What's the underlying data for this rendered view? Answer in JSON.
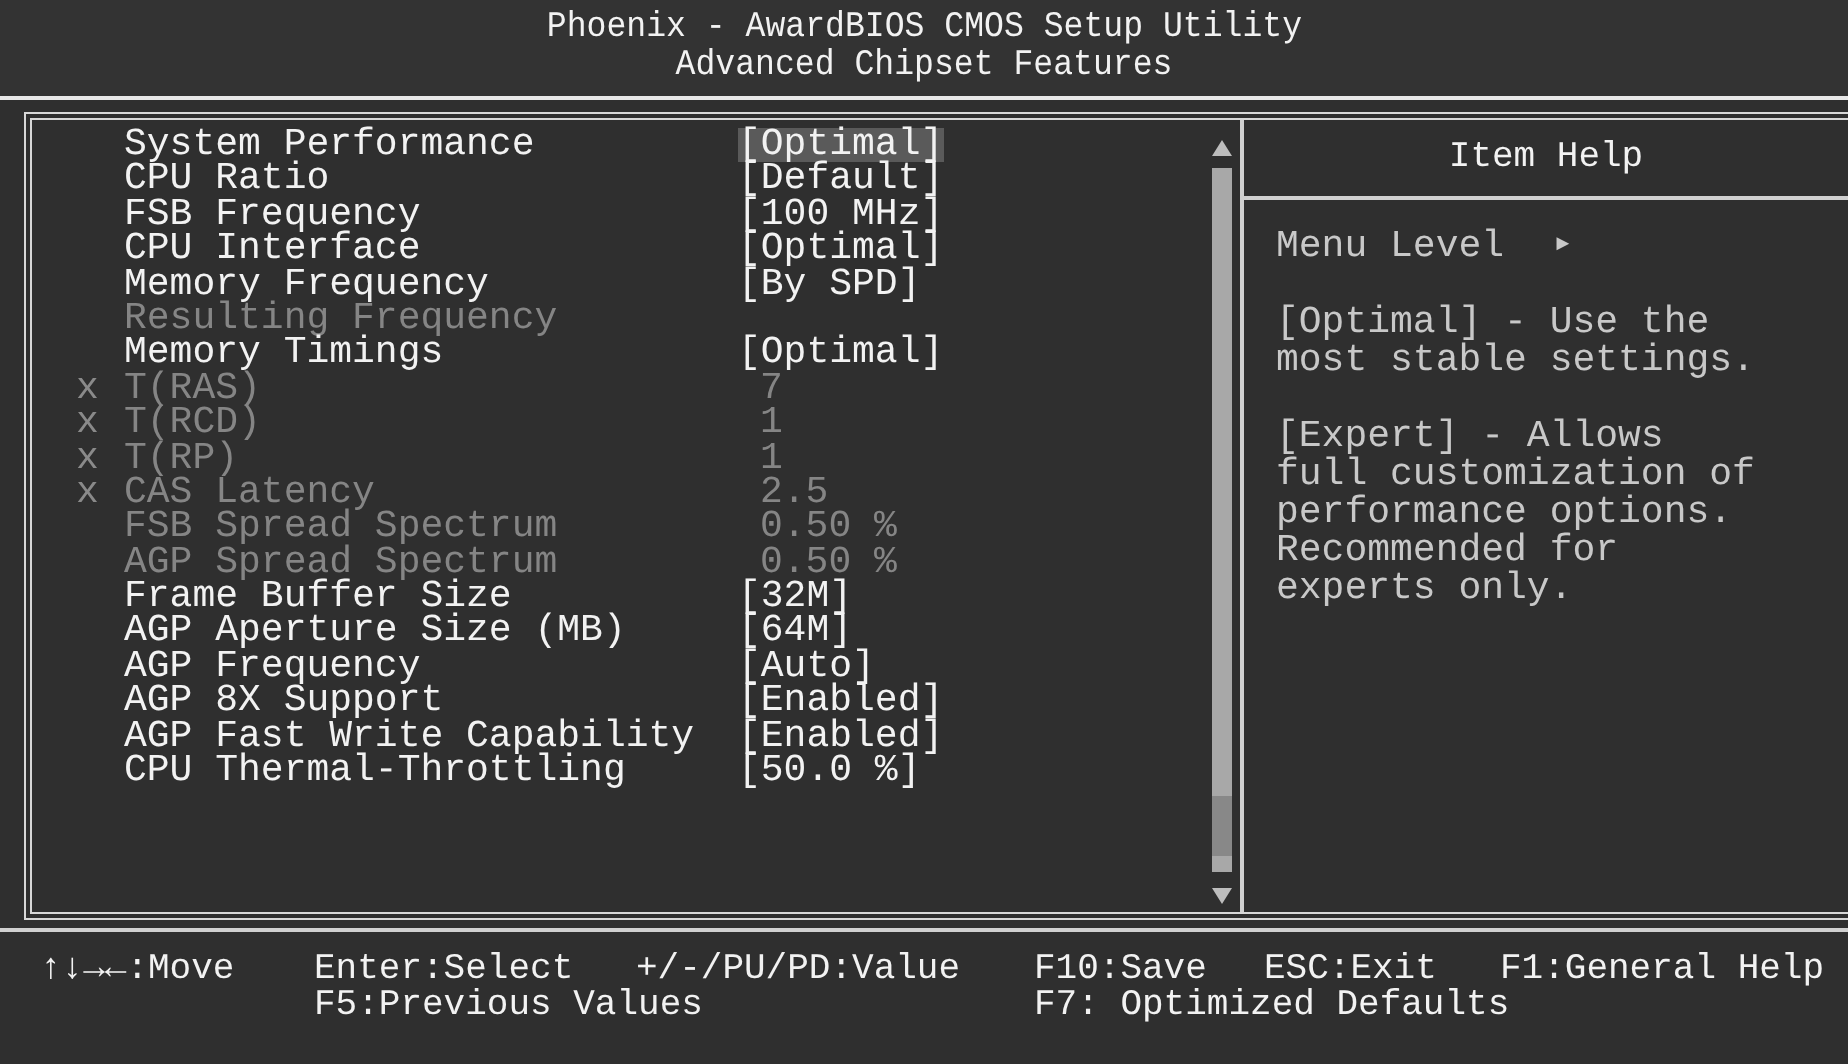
{
  "title": "Phoenix - AwardBIOS CMOS Setup Utility",
  "subtitle": "Advanced Chipset Features",
  "items": [
    {
      "label": "System Performance",
      "value": "[Optimal]",
      "disabled": false,
      "selected": true
    },
    {
      "label": "CPU Ratio",
      "value": "[Default]",
      "disabled": false,
      "selected": false
    },
    {
      "label": "FSB Frequency",
      "value": "[100 MHz]",
      "disabled": false,
      "selected": false
    },
    {
      "label": "CPU Interface",
      "value": "[Optimal]",
      "disabled": false,
      "selected": false
    },
    {
      "label": "Memory Frequency",
      "value": "[By SPD]",
      "disabled": false,
      "selected": false
    },
    {
      "label": "Resulting Frequency",
      "disabled": true,
      "selected": false
    },
    {
      "label": "Memory Timings",
      "value": "[Optimal]",
      "disabled": false,
      "selected": false
    },
    {
      "label": "T(RAS)",
      "value": "7",
      "disabled": true,
      "marker": "x",
      "selected": false
    },
    {
      "label": "T(RCD)",
      "value": "1",
      "disabled": true,
      "marker": "x",
      "selected": false
    },
    {
      "label": "T(RP)",
      "value": "1",
      "disabled": true,
      "marker": "x",
      "selected": false
    },
    {
      "label": "CAS Latency",
      "value": "2.5",
      "disabled": true,
      "marker": "x",
      "selected": false
    },
    {
      "label": "FSB Spread Spectrum",
      "value": "0.50 %",
      "disabled": true,
      "selected": false
    },
    {
      "label": "AGP Spread Spectrum",
      "value": "0.50 %",
      "disabled": true,
      "selected": false
    },
    {
      "label": "Frame Buffer Size",
      "value": "[32M]",
      "disabled": false,
      "selected": false
    },
    {
      "label": "AGP Aperture Size (MB)",
      "value": "[64M]",
      "disabled": false,
      "selected": false
    },
    {
      "label": "AGP Frequency",
      "value": "[Auto]",
      "disabled": false,
      "selected": false
    },
    {
      "label": "AGP 8X Support",
      "value": "[Enabled]",
      "disabled": false,
      "selected": false
    },
    {
      "label": "AGP Fast Write Capability",
      "value": "[Enabled]",
      "disabled": false,
      "selected": false
    },
    {
      "label": "CPU Thermal-Throttling",
      "value": "[50.0 %]",
      "disabled": false,
      "selected": false
    }
  ],
  "help": {
    "title": "Item Help",
    "menu_level": "Menu Level",
    "menu_level_arrow": "►",
    "paragraphs": [
      "[Optimal] - Use the most stable settings.",
      "[Expert] - Allows full customization of performance options. Recommended for experts only."
    ]
  },
  "footer": {
    "row_1": [
      "↑↓→←:Move",
      "Enter:Select",
      "+/-/PU/PD:Value",
      "F10:Save",
      "ESC:Exit",
      "F1:General Help"
    ],
    "row_2": [
      "F5:Previous Values",
      "F7: Optimized Defaults"
    ]
  }
}
